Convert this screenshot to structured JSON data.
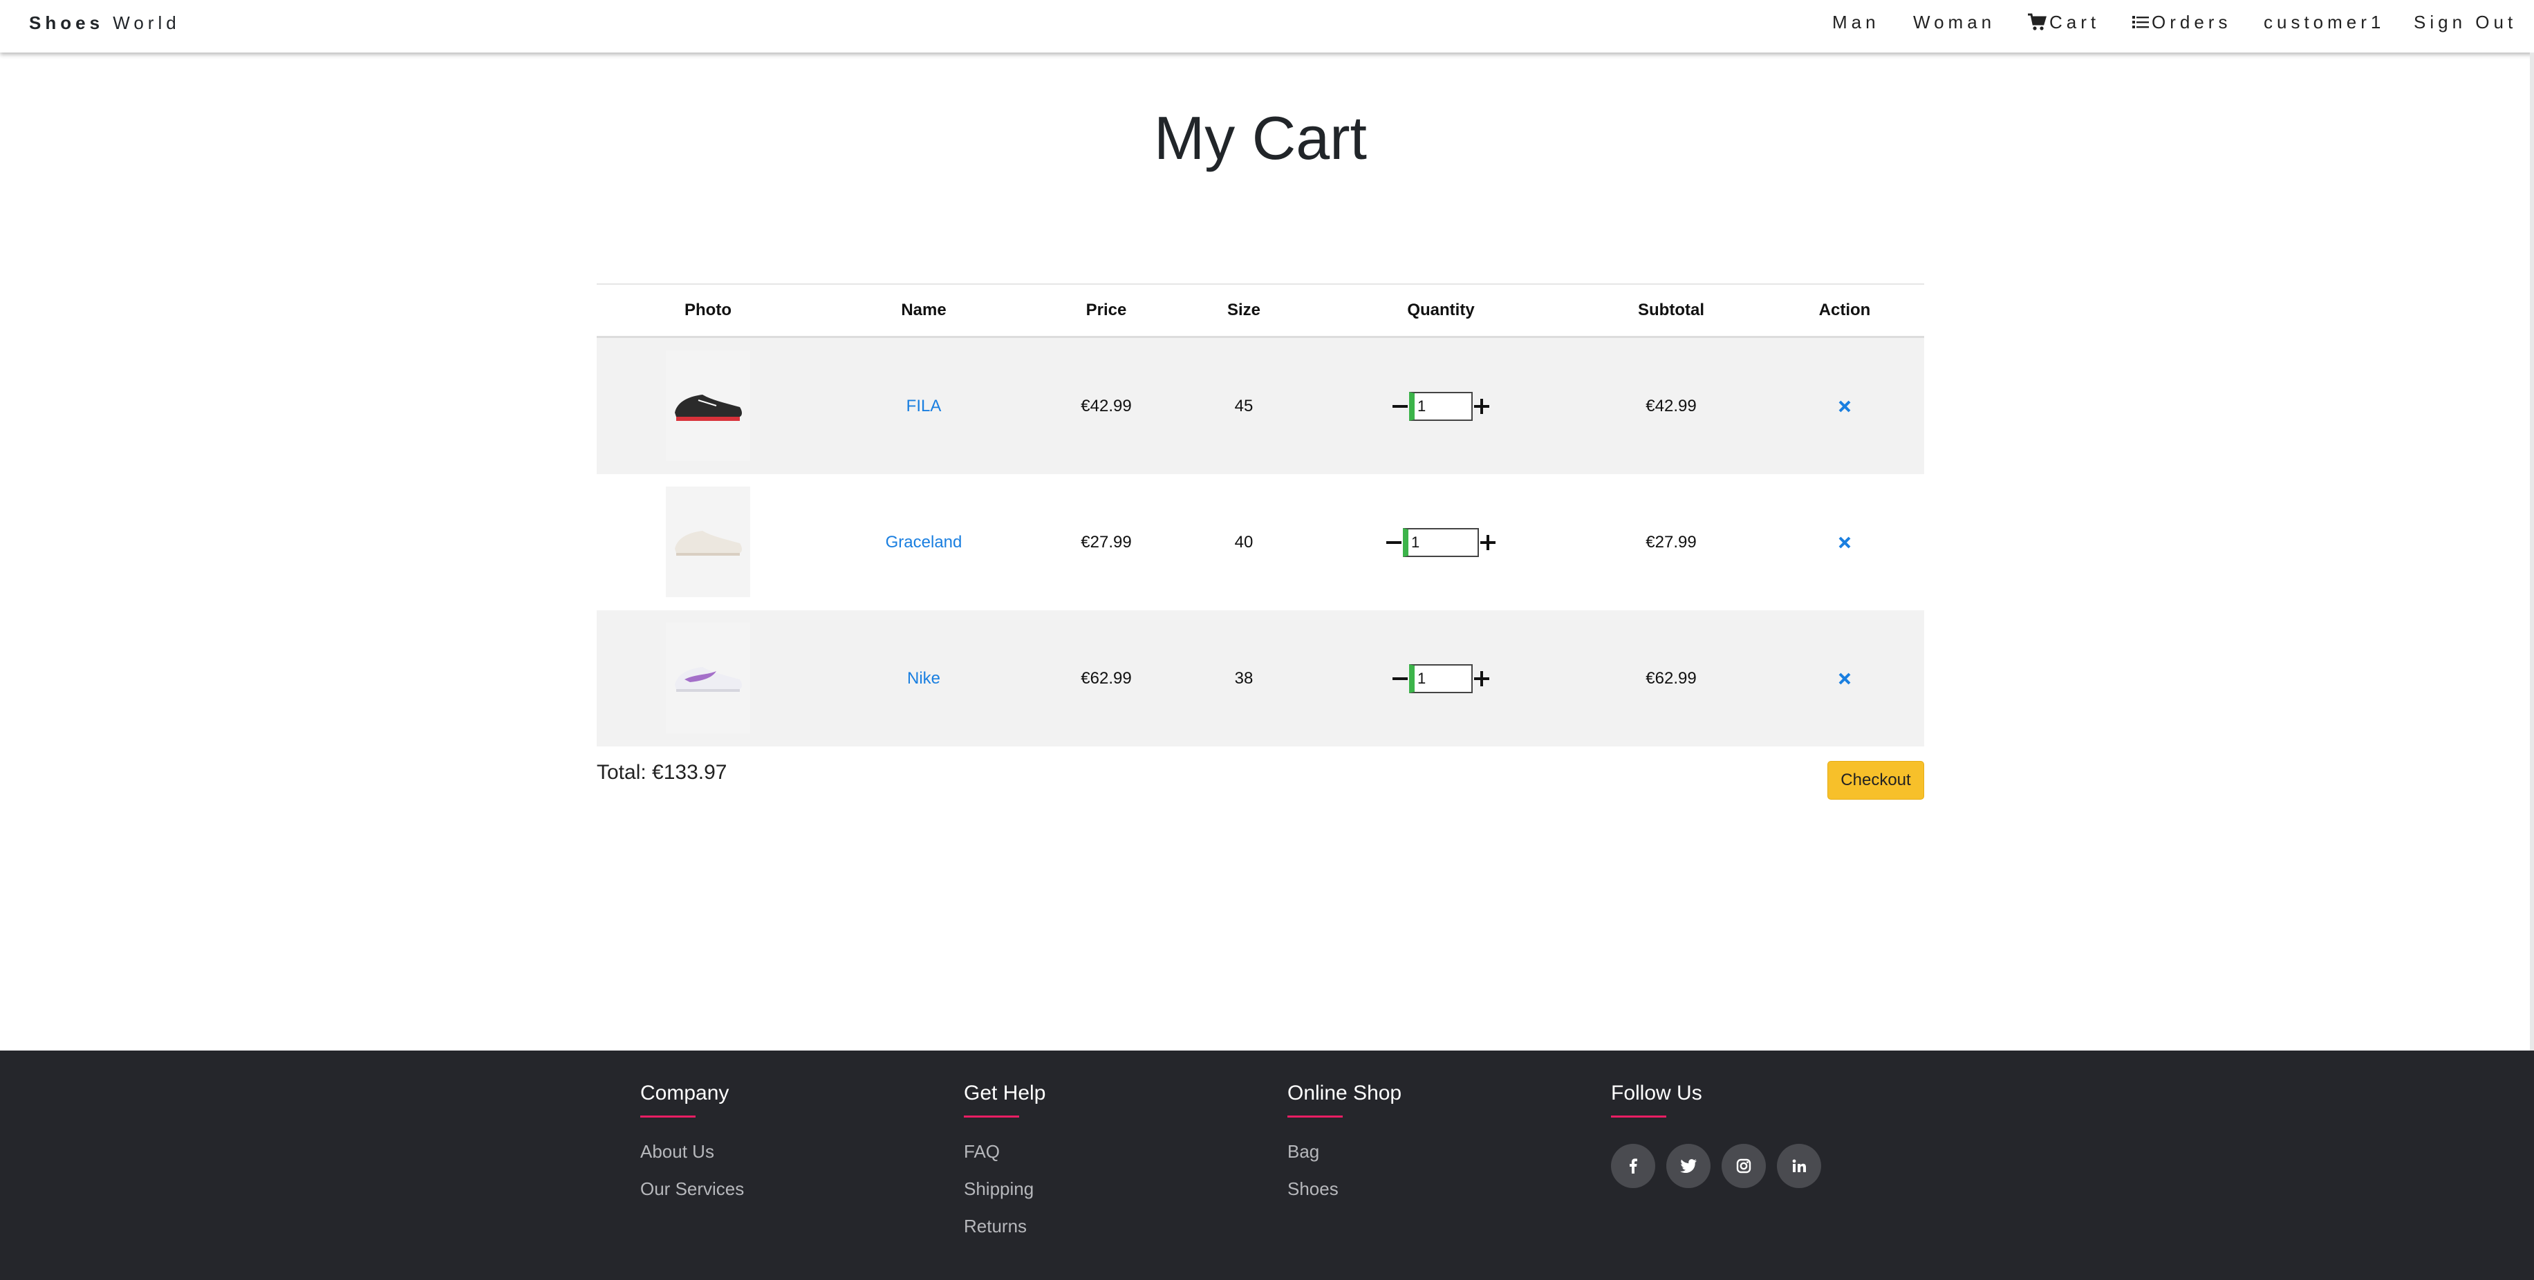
{
  "navbar": {
    "brand_bold": "Shoes",
    "brand_rest": "World",
    "items": {
      "man": "Man",
      "woman": "Woman",
      "cart": "Cart",
      "orders": "Orders",
      "user": "customer1",
      "signout": "Sign Out"
    }
  },
  "page": {
    "title": "My Cart"
  },
  "cart": {
    "headers": {
      "photo": "Photo",
      "name": "Name",
      "price": "Price",
      "size": "Size",
      "quantity": "Quantity",
      "subtotal": "Subtotal",
      "action": "Action"
    },
    "rows": [
      {
        "name": "FILA",
        "price": "€42.99",
        "size": "45",
        "quantity": "1",
        "subtotal": "€42.99",
        "shoe_color": "#2b2b2b",
        "accent": "#d8323a"
      },
      {
        "name": "Graceland",
        "price": "€27.99",
        "size": "40",
        "quantity": "1",
        "subtotal": "€27.99",
        "shoe_color": "#ece7df",
        "accent": "#d9cfc2"
      },
      {
        "name": "Nike",
        "price": "€62.99",
        "size": "38",
        "quantity": "1",
        "subtotal": "€62.99",
        "shoe_color": "#eeeef4",
        "accent": "#a46fc9"
      }
    ],
    "total_label": "Total: €133.97",
    "checkout_label": "Checkout"
  },
  "footer": {
    "company": {
      "title": "Company",
      "links": [
        "About Us",
        "Our Services"
      ]
    },
    "help": {
      "title": "Get Help",
      "links": [
        "FAQ",
        "Shipping",
        "Returns"
      ]
    },
    "shop": {
      "title": "Online Shop",
      "links": [
        "Bag",
        "Shoes"
      ]
    },
    "follow": {
      "title": "Follow Us",
      "icons": [
        "facebook-icon",
        "twitter-icon",
        "instagram-icon",
        "linkedin-icon"
      ]
    }
  },
  "colors": {
    "link": "#1a7fe0",
    "checkout": "#f7c02a",
    "footer_bg": "#25262b",
    "footer_accent": "#e91e63",
    "qty_accent": "#3cb44a"
  }
}
